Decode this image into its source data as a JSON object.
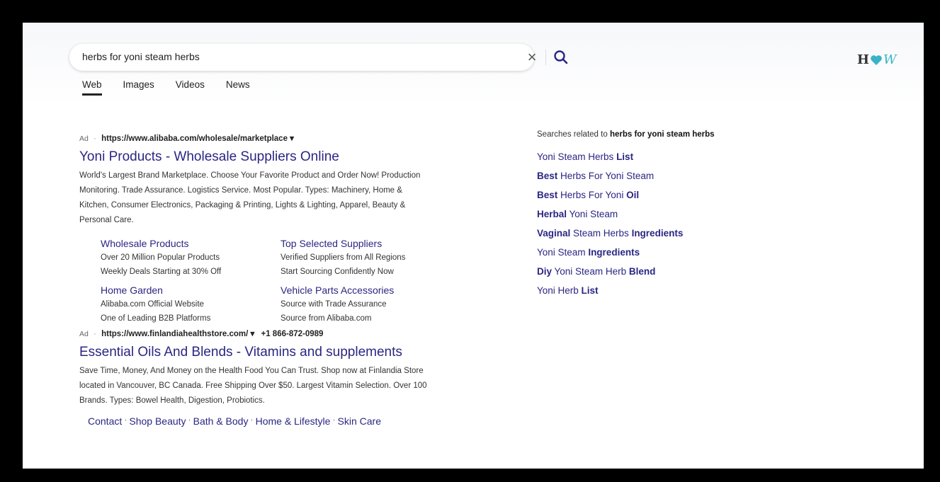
{
  "search": {
    "query": "herbs for yoni steam herbs",
    "clear_icon": "close-icon",
    "search_icon": "search-icon"
  },
  "tabs": [
    "Web",
    "Images",
    "Videos",
    "News"
  ],
  "logo": {
    "h": "H",
    "w": "W",
    "heart_color": "#39b3c6"
  },
  "results": [
    {
      "ad_label": "Ad",
      "url": "https://www.alibaba.com/wholesale/marketplace ▾",
      "title": "Yoni Products - Wholesale Suppliers Online",
      "desc_lines": [
        "World's Largest Brand Marketplace. Choose Your Favorite Product and Order Now! Production",
        "Monitoring. Trade Assurance. Logistics Service. Most Popular. Types: Machinery, Home &",
        "Kitchen, Consumer Electronics, Packaging & Printing, Lights & Lighting, Apparel, Beauty &",
        "Personal Care."
      ],
      "sitelinks": [
        {
          "title": "Wholesale Products",
          "lines": [
            "Over 20 Million Popular Products",
            "Weekly Deals Starting at 30% Off"
          ]
        },
        {
          "title": "Top Selected Suppliers",
          "lines": [
            "Verified Suppliers from All Regions",
            "Start Sourcing Confidently Now"
          ]
        },
        {
          "title": "Home Garden",
          "lines": [
            "Alibaba.com Official Website",
            "One of Leading B2B Platforms"
          ]
        },
        {
          "title": "Vehicle Parts Accessories",
          "lines": [
            "Source with Trade Assurance",
            "Source from Alibaba.com"
          ]
        }
      ]
    },
    {
      "ad_label": "Ad",
      "url": "https://www.finlandiahealthstore.com/ ▾",
      "phone": "+1 866-872-0989",
      "title": "Essential Oils And Blends - Vitamins and supplements",
      "desc_lines": [
        "Save Time, Money, And Money on the Health Food You Can Trust. Shop now at Finlandia Store",
        "located in Vancouver, BC Canada. Free Shipping Over $50. Largest Vitamin Selection. Over 100",
        "Brands. Types: Bowel Health, Digestion, Probiotics."
      ],
      "inline_links": [
        "Contact",
        "Shop Beauty",
        "Bath & Body",
        "Home & Lifestyle",
        "Skin Care"
      ]
    }
  ],
  "related": {
    "head_prefix": "Searches related to",
    "head_query": "herbs for yoni steam herbs",
    "items": [
      {
        "a": "Yoni Steam Herbs ",
        "b": "List",
        "c": ""
      },
      {
        "a": "",
        "b": "Best",
        "c": " Herbs For Yoni Steam"
      },
      {
        "a": "",
        "b": "Best",
        "c": " Herbs For Yoni ",
        "d": "Oil"
      },
      {
        "a": "",
        "b": "Herbal",
        "c": " Yoni Steam"
      },
      {
        "a": "",
        "b": "Vaginal",
        "c": " Steam Herbs ",
        "d": "Ingredients"
      },
      {
        "a": "Yoni Steam ",
        "b": "Ingredients",
        "c": ""
      },
      {
        "a": "",
        "b": "Diy",
        "c": " Yoni Steam Herb ",
        "d": "Blend"
      },
      {
        "a": "Yoni Herb ",
        "b": "List",
        "c": ""
      }
    ]
  }
}
